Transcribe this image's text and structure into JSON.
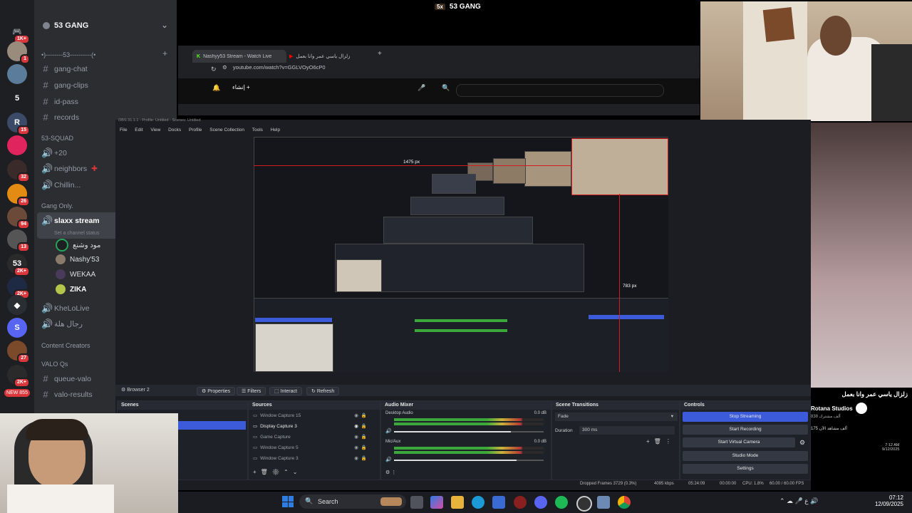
{
  "stream": {
    "title_badge": "5x",
    "title": "53 GANG"
  },
  "discord": {
    "server_name": "53 GANG",
    "rail_badges": [
      "1K+",
      "1",
      "5",
      "15",
      "32",
      "26",
      "94",
      "13",
      "2K+",
      "2K+",
      "27",
      "2K+",
      "NEW 855"
    ],
    "categories": {
      "top_divider": "•)--------53----------(•",
      "squad": "53-SQUAD",
      "gang_only": "Gang Only.",
      "content_creators": "Content Creators",
      "valo_qs": "VALO Qs"
    },
    "channels": [
      "gang-chat",
      "gang-clips",
      "id-pass",
      "records",
      "+20",
      "neighbors",
      "Chillin...",
      "KheLoLive",
      "رجال هلة",
      "queue-valo",
      "valo-results"
    ],
    "active_channel": {
      "name": "slaxx stream",
      "status": "Set a channel status"
    },
    "voice_users": [
      "مود وشنع",
      "Nashy'53",
      "WEKAA",
      "ZIKA"
    ]
  },
  "browser": {
    "tabs": [
      "Nashyy53 Stream - Watch Live",
      "زلزال ياسي عمر وانا بعمل"
    ],
    "url": "youtube.com/watch?v=GGLVOyO6cP0",
    "create_label": "إنشاء"
  },
  "obs": {
    "title": "OBS 31.1.1 - Profile: Untitled - Scenes: Untitled",
    "menu": [
      "File",
      "Edit",
      "View",
      "Docks",
      "Profile",
      "Scene Collection",
      "Tools",
      "Help"
    ],
    "measure_h": "1475 px",
    "measure_v": "783 px",
    "selected_source": "Browser 2",
    "toolbar": [
      "Properties",
      "Filters",
      "Interact",
      "Refresh"
    ],
    "docks": {
      "scenes": "Scenes",
      "sources": "Sources",
      "audio": "Audio Mixer",
      "transitions": "Scene Transitions",
      "controls": "Controls"
    },
    "sources_list": [
      "Window Capture 15",
      "Display Capture 3",
      "Game Capture",
      "Window Capture 5",
      "Window Capture 3"
    ],
    "audio": {
      "channels": [
        {
          "name": "Desktop Audio",
          "db": "0.0 dB",
          "level": 0.78
        },
        {
          "name": "Mic/Aux",
          "db": "0.0 dB",
          "level": 0.82
        }
      ]
    },
    "transition": {
      "type": "Fade",
      "duration_label": "Duration",
      "duration": "300 ms"
    },
    "controls": [
      "Stop Streaming",
      "Start Recording",
      "Start Virtual Camera",
      "Studio Mode",
      "Settings"
    ],
    "status": {
      "dropped": "Dropped Frames 3729 (0.3%)",
      "bitrate": "4095 kbps",
      "live_time": "05:24:09",
      "rec_time": "00:00:00",
      "cpu": "CPU: 1.8%",
      "fps": "60.00 / 60.00 FPS"
    }
  },
  "yt_side": {
    "title": "زلزال ياسي عمر وانا بعمل",
    "channel": "Rotana Studios",
    "subs": "838 ألف مشترك",
    "viewers": "175 ألف مشاهد الآن",
    "time": "7:12 AM",
    "date": "9/12/2025"
  },
  "taskbar": {
    "search_label": "Search",
    "time": "07:12",
    "date": "12/09/2025"
  }
}
